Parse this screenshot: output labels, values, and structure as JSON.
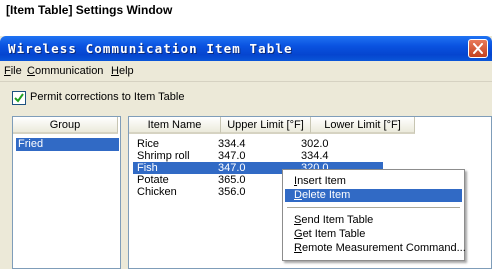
{
  "caption": "[Item Table] Settings Window",
  "window": {
    "title": "Wireless Communication  Item Table",
    "close_icon": "close-icon"
  },
  "menu": [
    "File",
    "Communication",
    "Help"
  ],
  "permit": {
    "label": "Permit corrections to Item Table",
    "checked": true
  },
  "group": {
    "header": "Group",
    "items": [
      "Fried"
    ],
    "selected": "Fried"
  },
  "items": {
    "headers": [
      "Item Name",
      "Upper Limit [°F]",
      "Lower Limit [°F]"
    ],
    "rows": [
      [
        "Rice",
        "334.4",
        "302.0"
      ],
      [
        "Shrimp roll",
        "347.0",
        "334.4"
      ],
      [
        "Fish",
        "347.0",
        "320.0"
      ],
      [
        "Potate",
        "365.0",
        ""
      ],
      [
        "Chicken",
        "356.0",
        ""
      ]
    ],
    "selected_row": "Fish"
  },
  "context_menu": {
    "items": [
      "Insert Item",
      "Delete Item",
      "Send Item Table",
      "Get Item Table",
      "Remote Measurement Command..."
    ],
    "highlighted": "Delete Item"
  },
  "colors": {
    "titlebar": "#0a52e0",
    "selection": "#316ac5",
    "close": "#c4411f"
  }
}
